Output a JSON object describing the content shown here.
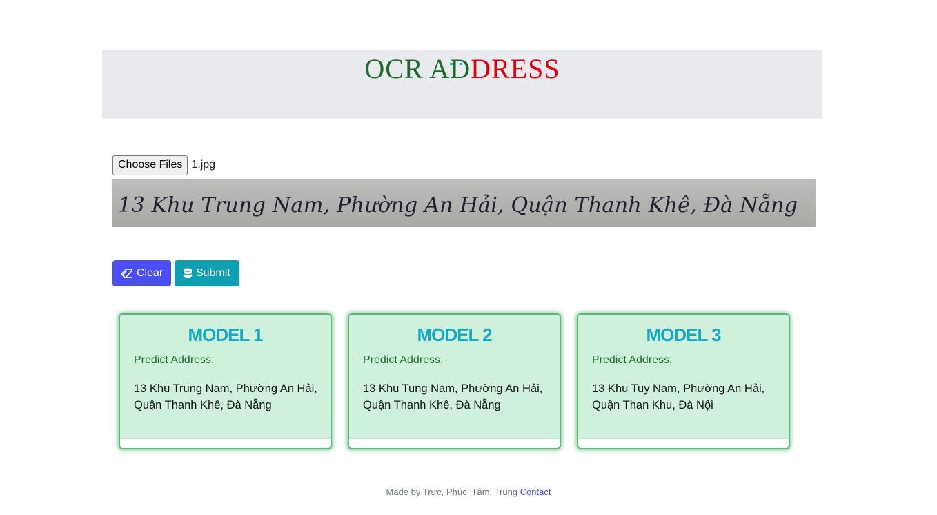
{
  "header": {
    "title_green": "OCR AD",
    "title_red": "DRESS"
  },
  "upload": {
    "button_label": "Choose Files",
    "file_name": "1.jpg"
  },
  "preview": {
    "handwritten_text": "13 Khu Trung Nam, Phường An Hải, Quận Thanh Khê, Đà Nẵng"
  },
  "actions": {
    "clear_label": "Clear",
    "submit_label": "Submit"
  },
  "models": [
    {
      "title": "MODEL 1",
      "label": "Predict Address:",
      "address": "13 Khu Trung Nam, Phường An Hải, Quận Thanh Khê, Đà Nẵng"
    },
    {
      "title": "MODEL 2",
      "label": "Predict Address:",
      "address": "13 Khu Tung Nam, Phường An Hải, Quận Thanh Khê, Đà Nẵng"
    },
    {
      "title": "MODEL 3",
      "label": "Predict Address:",
      "address": "13 Khu Tuy Nam, Phường An Hải, Quận Than Khu, Đà Nội"
    }
  ],
  "footer": {
    "text": "Made by Trực, Phúc, Tâm, Trung",
    "link_label": "Contact"
  },
  "colors": {
    "title_green": "#1b6b2c",
    "title_red": "#e0000b",
    "clear_button": "#4a4ef5",
    "submit_button": "#0e9fb2",
    "card_bg": "#cff1db",
    "card_title": "#16a8c4"
  },
  "icons": {
    "clear": "eraser-icon",
    "submit": "database-icon"
  }
}
